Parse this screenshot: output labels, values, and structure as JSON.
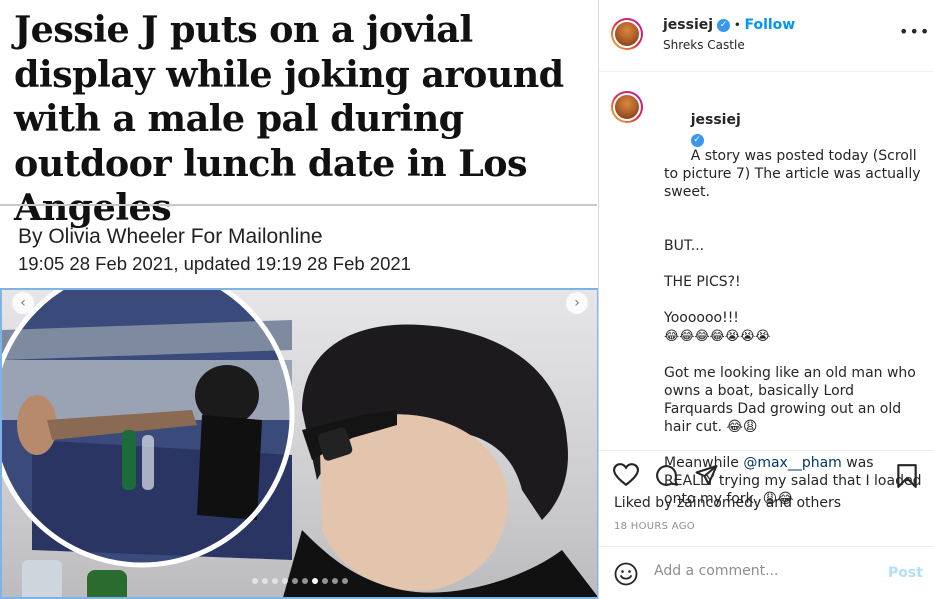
{
  "article": {
    "headline": "Jessie J puts on a jovial display while joking around with a male pal during outdoor lunch date in Los Angeles",
    "byline": "By Olivia Wheeler For Mailonline",
    "dateline": "19:05 28 Feb 2021, updated 19:19 28 Feb 2021"
  },
  "carousel": {
    "prev_icon": "chevron-left-icon",
    "next_icon": "chevron-right-icon",
    "dot_count": 10,
    "active_dot_index": 6
  },
  "post": {
    "username": "jessiej",
    "follow_label": "Follow",
    "location": "Shreks Castle",
    "more_icon": "more-options-icon",
    "caption": {
      "username": "jessiej",
      "line1": "A story was posted today (Scroll to picture 7) The article was actually sweet.",
      "line2": "BUT...",
      "line3": "THE PICS?!",
      "line4": "Yoooooo!!!",
      "line4_emoji": "😂😂😂😂😭😭😭",
      "line5": "Got me looking like an old man who owns a boat, basically Lord Farquards Dad growing out an old hair cut. 😂😩",
      "line6_prefix": "Meanwhile ",
      "line6_mention": "@max__pham",
      "line6_suffix": " was REALLY trying my salad that I loaded onto my fork. 😩😂"
    },
    "likes_text": "Liked by zaincomedy and others",
    "time_text": "18 HOURS AGO",
    "comment_placeholder": "Add a comment...",
    "post_label": "Post"
  },
  "colors": {
    "accent": "#0095f6",
    "verified": "#3897f0",
    "text": "#262626",
    "muted": "#8e8e8e"
  }
}
